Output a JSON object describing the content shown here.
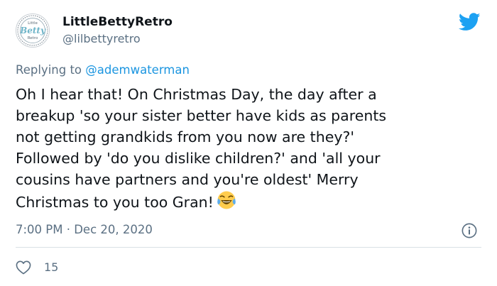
{
  "user": {
    "display_name": "LittleBettyRetro",
    "handle": "@lilbettyretro",
    "avatar": {
      "top_text": "Little",
      "script_text": "Betty",
      "bottom_text": "Retro"
    }
  },
  "reply": {
    "prefix": "Replying to",
    "to_handle": "@ademwaterman"
  },
  "tweet": {
    "lines": [
      "Oh I hear that! On Christmas Day, the day after a",
      "breakup 'so your sister better have kids as parents",
      "not getting grandkids from you now are they?'",
      "Followed by 'do you dislike children?' and 'all your",
      "cousins have partners and you're oldest' Merry",
      "Christmas to you too Gran!"
    ],
    "emoji": "face-with-tears-of-joy"
  },
  "meta": {
    "timestamp": "7:00 PM · Dec 20, 2020"
  },
  "actions": {
    "like_count": "15"
  },
  "colors": {
    "text": "#0f1419",
    "secondary": "#5b7083",
    "link": "#1b95e0",
    "twitter_blue": "#1da1f2",
    "divider": "#d9e0e6"
  },
  "icons": [
    "twitter-bird-icon",
    "info-icon",
    "heart-icon",
    "laughing-tears-emoji"
  ]
}
